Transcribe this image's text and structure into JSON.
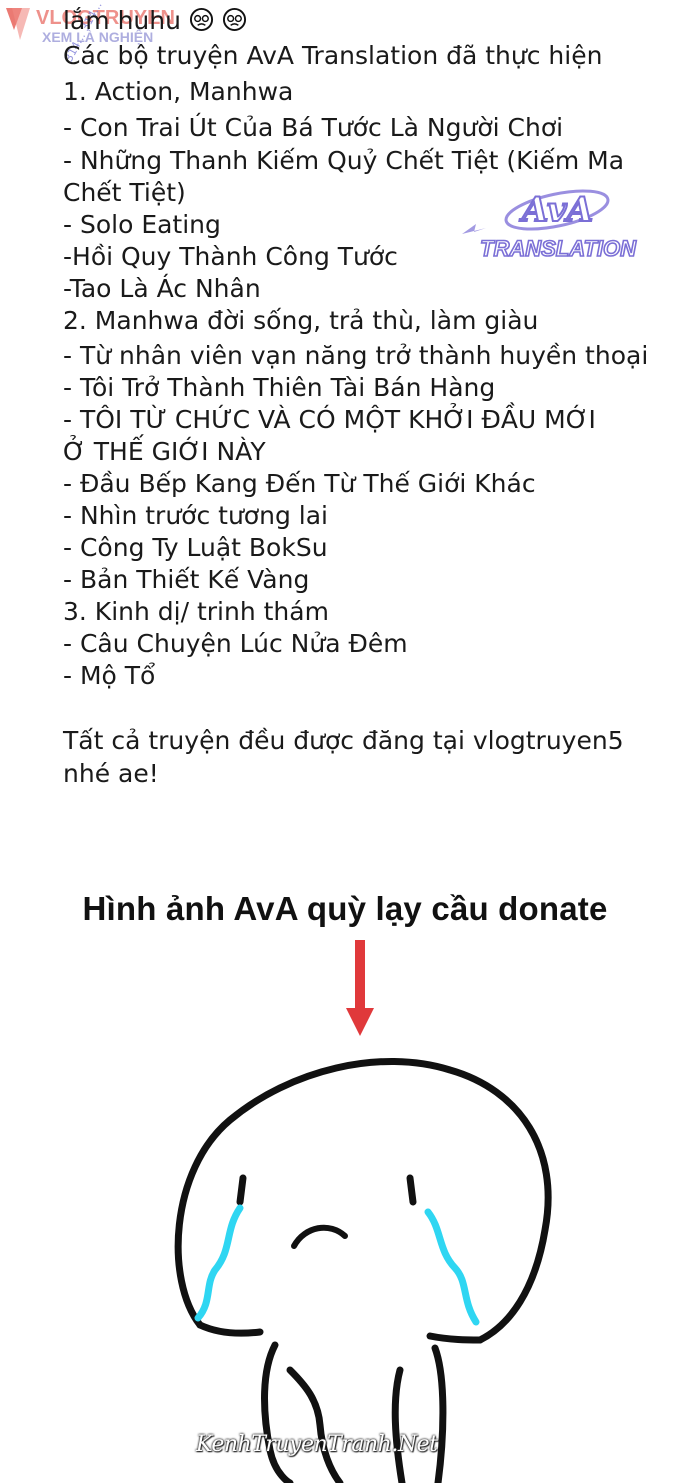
{
  "watermark": {
    "site_logo": "VLOGTRUYEN",
    "site_tagline": "XEM LÀ NGHIỆN",
    "small_text": "314... 314..."
  },
  "ava_logo": {
    "brand": "AvA",
    "subtitle": "TRANSLATION"
  },
  "text_lines": [
    {
      "text": "lắm huhu"
    },
    {
      "text": "Các bộ truyện AvA Translation đã thực hiện"
    },
    {
      "text": "1. Action, Manhwa"
    },
    {
      "text": "- Con Trai Út Của Bá Tước Là Người Chơi"
    },
    {
      "text": "- Những Thanh Kiếm Quỷ Chết Tiệt (Kiếm Ma"
    },
    {
      "text": "Chết Tiệt)"
    },
    {
      "text": "- Solo Eating"
    },
    {
      "text": "-Hồi Quy Thành Công Tước"
    },
    {
      "text": "-Tao Là Ác Nhân"
    },
    {
      "text": "2.  Manhwa đời sống, trả thù, làm giàu"
    },
    {
      "text": "- Từ nhân viên vạn năng trở thành huyền thoại"
    },
    {
      "text": "- Tôi Trở Thành Thiên Tài Bán Hàng"
    },
    {
      "text": "- TÔI TỪ CHỨC VÀ CÓ MỘT KHỞI ĐẦU MỚI"
    },
    {
      "text": "Ở THẾ GIỚI NÀY"
    },
    {
      "text": "- Đầu Bếp Kang Đến Từ Thế Giới Khác"
    },
    {
      "text": "- Nhìn trước tương lai"
    },
    {
      "text": "- Công Ty Luật BokSu"
    },
    {
      "text": "- Bản Thiết Kế Vàng"
    },
    {
      "text": "3. Kinh dị/ trinh thám"
    },
    {
      "text": "- Câu Chuyện Lúc Nửa Đêm"
    },
    {
      "text": "- Mộ Tổ"
    },
    {
      "text": "Tất cả truyện đều được đăng tại vlogtruyen5"
    },
    {
      "text": "nhé ae!"
    }
  ],
  "headline": "Hình ảnh AvA quỳ lạy cầu donate",
  "credit": "KenhTruyenTranh.Net",
  "colors": {
    "arrow": "#e0393b",
    "tears": "#2fd6f2",
    "ink": "#111111",
    "ava_purple": "#7b6fd6"
  }
}
